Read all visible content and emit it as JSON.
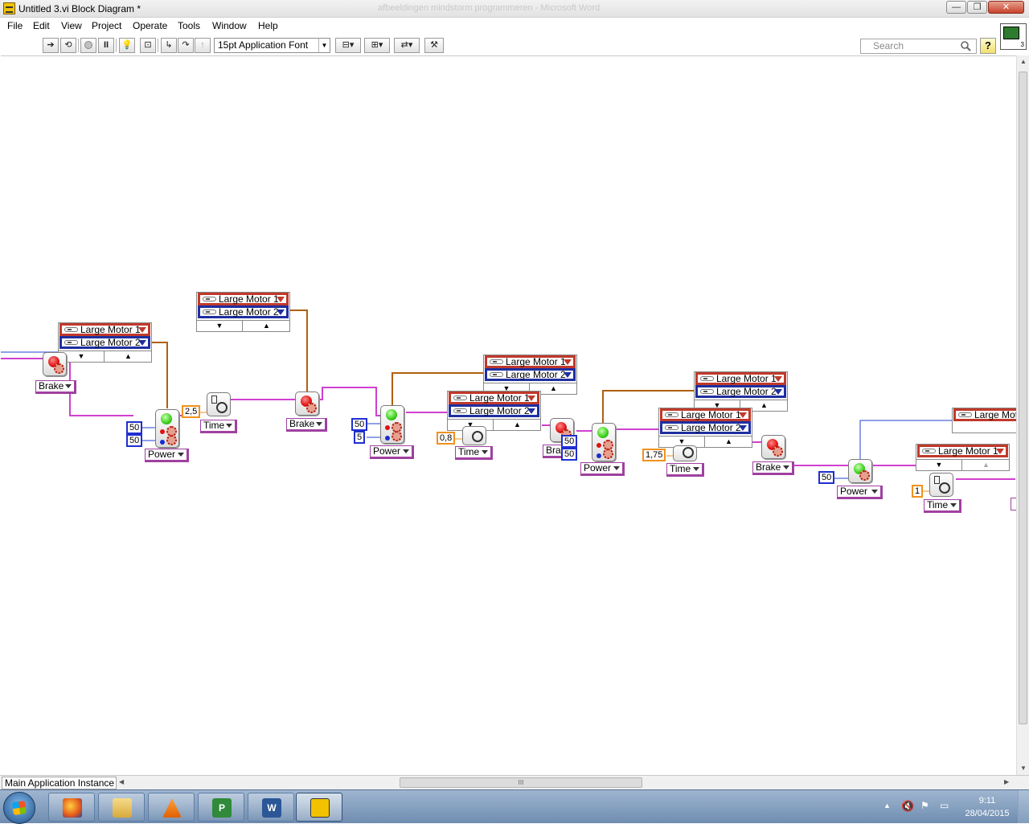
{
  "window": {
    "title": "Untitled 3.vi Block Diagram *",
    "background_title": "afbeeldingen mindstorm programmeren - Microsoft Word",
    "min_label": "—",
    "max_label": "❐",
    "close_label": "✕"
  },
  "menu": [
    "File",
    "Edit",
    "View",
    "Project",
    "Operate",
    "Tools",
    "Window",
    "Help"
  ],
  "toolbar": {
    "font_label": "15pt Application Font",
    "search_placeholder": "Search",
    "help_label": "?"
  },
  "vi_icon_number": "3",
  "statusbar": {
    "context": "Main Application Instance",
    "scroll_grip": "III"
  },
  "clock": {
    "time": "9:11",
    "date": "28/04/2015"
  },
  "diagram": {
    "port_labels": [
      "Large Motor 1",
      "Large Motor 2",
      "Large Mot"
    ],
    "modes": [
      "Brake",
      "Power",
      "Time",
      "Time",
      "Brake",
      "Power",
      "Time",
      "Brake",
      "Power",
      "Time",
      "Brake",
      "Power",
      "Time"
    ],
    "constants": [
      "50",
      "50",
      "2,5",
      "50",
      "5",
      "0,8",
      "50",
      "50",
      "1,75",
      "50",
      "1"
    ]
  },
  "colors": {
    "motor_port_red": "#c0392b",
    "motor_port_blue": "#1f2fa0",
    "wire_pink": "#d040d0",
    "wire_orange": "#b06010",
    "wire_blue": "#2040d0",
    "const_blue": "#1f2fd0",
    "const_orange": "#f0921e"
  }
}
